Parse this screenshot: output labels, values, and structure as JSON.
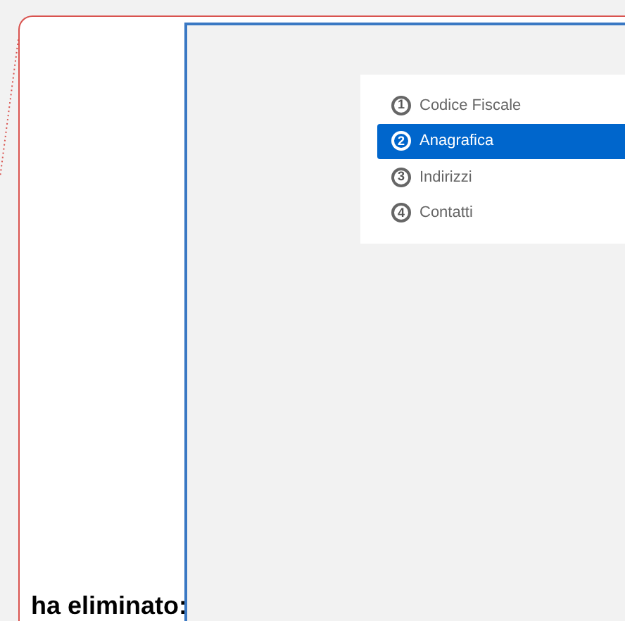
{
  "steps": [
    {
      "number": "1",
      "label": "Codice Fiscale",
      "selected": false
    },
    {
      "number": "2",
      "label": "Anagrafica",
      "selected": true
    },
    {
      "number": "3",
      "label": "Indirizzi",
      "selected": false
    },
    {
      "number": "4",
      "label": "Contatti",
      "selected": false
    }
  ],
  "heading": "ha eliminato:"
}
